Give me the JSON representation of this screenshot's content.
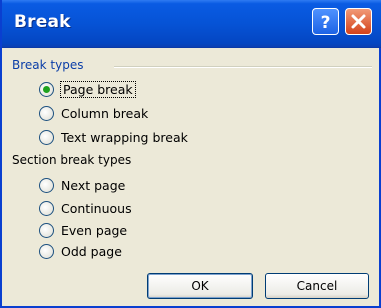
{
  "dialog": {
    "title": "Break",
    "help_icon": "question-icon",
    "close_icon": "close-icon"
  },
  "break_types": {
    "label": "Break types",
    "options": [
      {
        "label": "Page break",
        "selected": true
      },
      {
        "label": "Column break",
        "selected": false
      },
      {
        "label": "Text wrapping break",
        "selected": false
      }
    ]
  },
  "section_break_types": {
    "label": "Section break types",
    "options": [
      {
        "label": "Next page",
        "selected": false
      },
      {
        "label": "Continuous",
        "selected": false
      },
      {
        "label": "Even page",
        "selected": false
      },
      {
        "label": "Odd page",
        "selected": false
      }
    ]
  },
  "buttons": {
    "ok": "OK",
    "cancel": "Cancel"
  },
  "colors": {
    "titlebar": "#0653d6",
    "group_label": "#0b3ea8",
    "radio_selected": "#1ea21e"
  }
}
